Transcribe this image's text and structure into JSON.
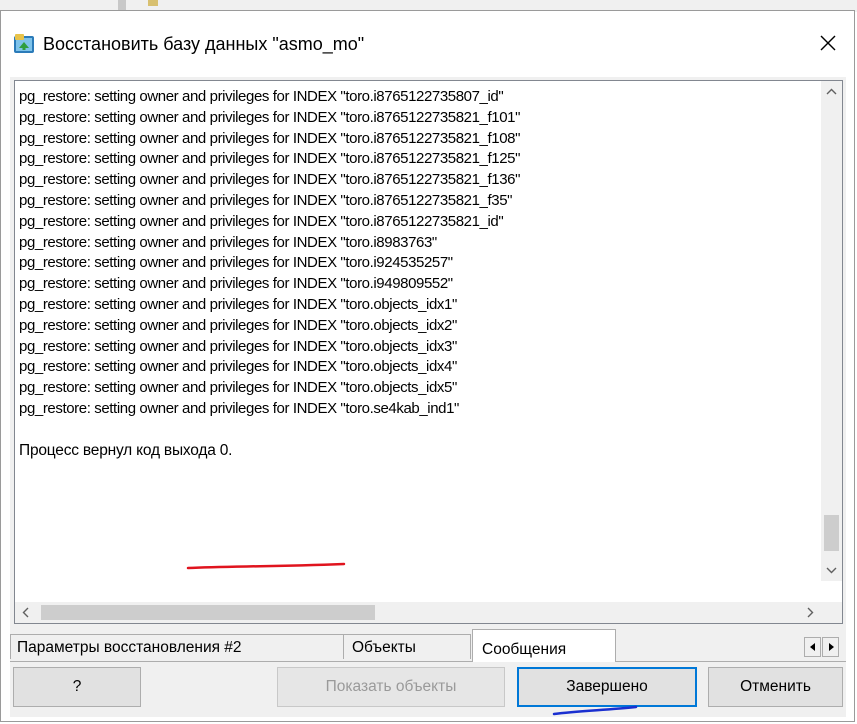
{
  "window": {
    "title": "Восстановить базу данных \"asmo_mo\""
  },
  "log": {
    "lines": [
      "pg_restore: setting owner and privileges for INDEX \"toro.i8765122735807_id\"",
      "pg_restore: setting owner and privileges for INDEX \"toro.i8765122735821_f101\"",
      "pg_restore: setting owner and privileges for INDEX \"toro.i8765122735821_f108\"",
      "pg_restore: setting owner and privileges for INDEX \"toro.i8765122735821_f125\"",
      "pg_restore: setting owner and privileges for INDEX \"toro.i8765122735821_f136\"",
      "pg_restore: setting owner and privileges for INDEX \"toro.i8765122735821_f35\"",
      "pg_restore: setting owner and privileges for INDEX \"toro.i8765122735821_id\"",
      "pg_restore: setting owner and privileges for INDEX \"toro.i8983763\"",
      "pg_restore: setting owner and privileges for INDEX \"toro.i924535257\"",
      "pg_restore: setting owner and privileges for INDEX \"toro.i949809552\"",
      "pg_restore: setting owner and privileges for INDEX \"toro.objects_idx1\"",
      "pg_restore: setting owner and privileges for INDEX \"toro.objects_idx2\"",
      "pg_restore: setting owner and privileges for INDEX \"toro.objects_idx3\"",
      "pg_restore: setting owner and privileges for INDEX \"toro.objects_idx4\"",
      "pg_restore: setting owner and privileges for INDEX \"toro.objects_idx5\"",
      "pg_restore: setting owner and privileges for INDEX \"toro.se4kab_ind1\""
    ],
    "exit_message": "Процесс вернул код выхода 0."
  },
  "tabs": [
    {
      "label": "Параметры восстановления #2",
      "active": false
    },
    {
      "label": "Объекты",
      "active": false
    },
    {
      "label": "Сообщения",
      "active": true
    }
  ],
  "buttons": {
    "help": "?",
    "show_objects": "Показать объекты",
    "done": "Завершено",
    "cancel": "Отменить"
  },
  "icons": {
    "app": "database-restore-icon",
    "close": "close-icon",
    "scroll_up": "chevron-up-icon",
    "scroll_down": "chevron-down-icon",
    "scroll_left": "chevron-left-icon",
    "scroll_right": "chevron-right-icon",
    "tab_left": "triangle-left-icon",
    "tab_right": "triangle-right-icon"
  },
  "colors": {
    "accent": "#0078d7",
    "annotation_red": "#e0141e",
    "annotation_blue": "#1a2fd0"
  }
}
